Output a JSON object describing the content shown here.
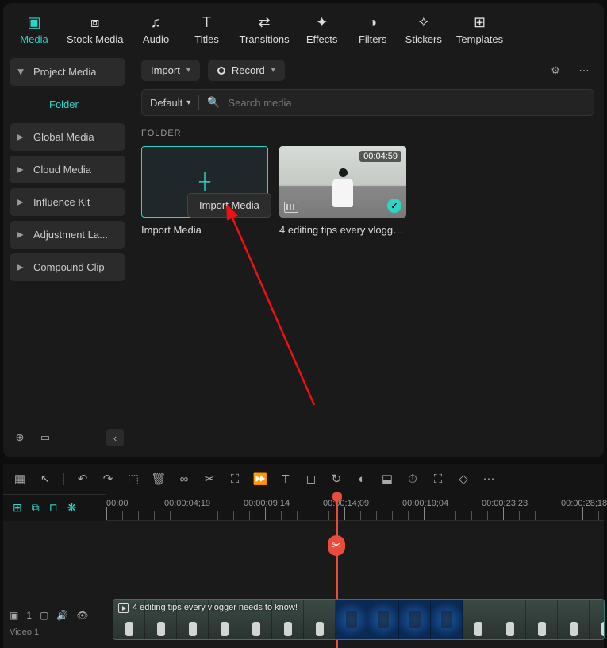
{
  "tabs": {
    "media": "Media",
    "stock": "Stock Media",
    "audio": "Audio",
    "titles": "Titles",
    "transitions": "Transitions",
    "effects": "Effects",
    "filters": "Filters",
    "stickers": "Stickers",
    "templates": "Templates"
  },
  "sidebar": {
    "project": "Project Media",
    "folder": "Folder",
    "global": "Global Media",
    "cloud": "Cloud Media",
    "influence": "Influence Kit",
    "adjustment": "Adjustment La...",
    "compound": "Compound Clip"
  },
  "topbar": {
    "import": "Import",
    "record": "Record"
  },
  "search": {
    "sort": "Default",
    "placeholder": "Search media"
  },
  "section": {
    "folder": "FOLDER"
  },
  "tiles": {
    "import_label": "Import Media",
    "tooltip": "Import Media",
    "clip_label": "4 editing tips every vlogger ...",
    "clip_duration": "00:04:59"
  },
  "ruler": {
    "t0": "00:00",
    "t1": "00:00:04;19",
    "t2": "00:00:09;14",
    "t3": "00:00:14;09",
    "t4": "00:00:19;04",
    "t5": "00:00:23;23",
    "t6": "00:00:28;18"
  },
  "timeline": {
    "video_track_num": "1",
    "video_track_name": "Video 1",
    "clip_title": "4 editing tips every vlogger needs to know!"
  }
}
